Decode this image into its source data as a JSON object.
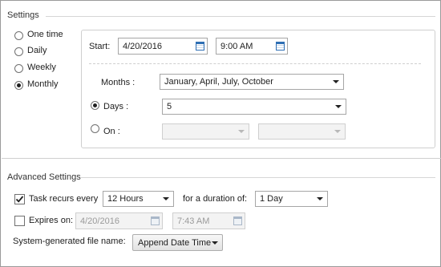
{
  "settings": {
    "title": "Settings",
    "recurrence": [
      {
        "label": "One time",
        "selected": false
      },
      {
        "label": "Daily",
        "selected": false
      },
      {
        "label": "Weekly",
        "selected": false
      },
      {
        "label": "Monthly",
        "selected": true
      }
    ],
    "start_label": "Start:",
    "start_date": "4/20/2016",
    "start_time": "9:00 AM",
    "months_label": "Months :",
    "months_value": "January, April, July, October",
    "days_label": "Days :",
    "days_value": "5",
    "days_selected": true,
    "on_label": "On :",
    "on_selected": false,
    "on_week_value": "",
    "on_day_value": ""
  },
  "advanced": {
    "title": "Advanced Settings",
    "recurs_label": "Task recurs every",
    "recurs_checked": true,
    "recurs_value": "12 Hours",
    "duration_label": "for a duration of:",
    "duration_value": "1 Day",
    "expires_label": "Expires on:",
    "expires_checked": false,
    "expires_date": "4/20/2016",
    "expires_time": "7:43 AM",
    "filename_label": "System-generated file name:",
    "filename_value": "Append Date Time"
  },
  "icons": {
    "calendar": "calendar-icon",
    "dropdown": "chevron-down-icon",
    "check": "checkmark-icon"
  }
}
